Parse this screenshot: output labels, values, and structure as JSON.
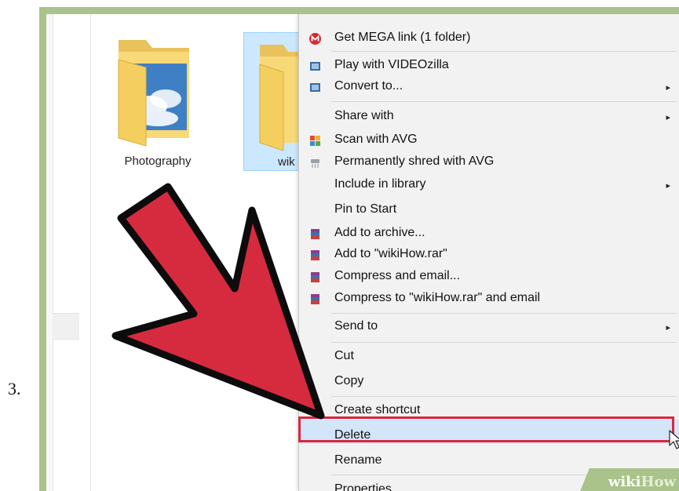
{
  "step_number": "3.",
  "folders": [
    {
      "label": "Photography"
    },
    {
      "label": "wik"
    }
  ],
  "context_menu": {
    "items": [
      {
        "label": "Get MEGA link (1 folder)",
        "icon": "mega-icon"
      },
      {
        "label": "Play with VIDEOzilla",
        "icon": "videozilla-icon"
      },
      {
        "label": "Convert to...",
        "icon": "videozilla-icon",
        "submenu": "▸"
      },
      {
        "label": "Share with",
        "submenu": "▸"
      },
      {
        "label": "Scan with AVG",
        "icon": "avg-icon"
      },
      {
        "label": "Permanently shred with AVG",
        "icon": "shred-icon"
      },
      {
        "label": "Include in library",
        "submenu": "▸"
      },
      {
        "label": "Pin to Start"
      },
      {
        "label": "Add to archive...",
        "icon": "winrar-icon"
      },
      {
        "label": "Add to \"wikiHow.rar\"",
        "icon": "winrar-icon"
      },
      {
        "label": "Compress and email...",
        "icon": "winrar-icon"
      },
      {
        "label": "Compress to \"wikiHow.rar\" and email",
        "icon": "winrar-icon"
      },
      {
        "label": "Send to",
        "submenu": "▸"
      },
      {
        "label": "Cut"
      },
      {
        "label": "Copy"
      },
      {
        "label": "Create shortcut"
      },
      {
        "label": "Delete",
        "highlighted": true
      },
      {
        "label": "Rename"
      },
      {
        "label": "Properties"
      }
    ]
  },
  "watermark": {
    "wiki": "wiki",
    "how": "How"
  },
  "colors": {
    "frame": "#a9c38a",
    "highlight_box": "#d8273e",
    "arrow_fill": "#d62b3f",
    "selection": "#cce8ff",
    "menu_bg": "#f2f2f2"
  }
}
